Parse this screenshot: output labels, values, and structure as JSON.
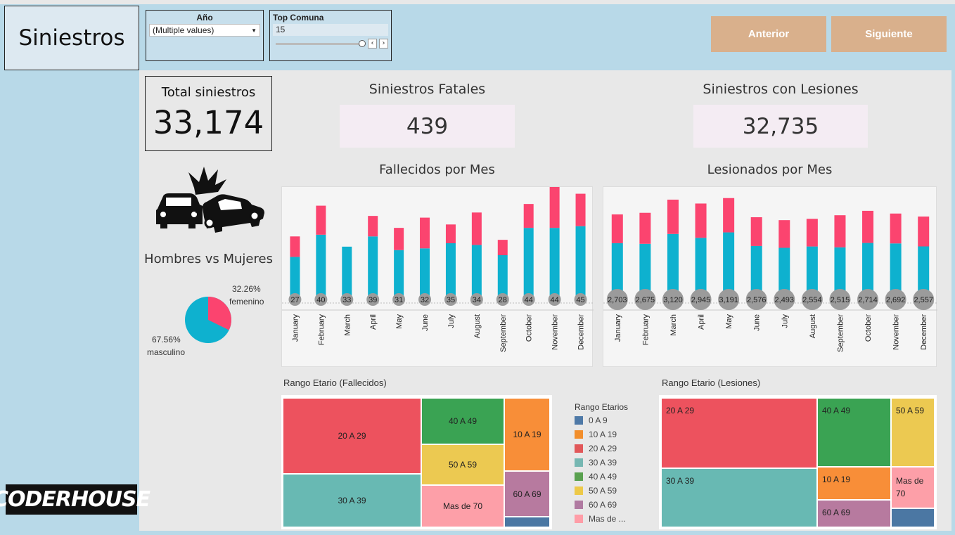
{
  "header": {
    "title": "Siniestros",
    "filters": {
      "year": {
        "label": "Año",
        "value": "(Multiple values)"
      },
      "top_comuna": {
        "label": "Top Comuna",
        "value": "15"
      }
    },
    "nav": {
      "prev_label": "Anterior",
      "next_label": "Siguiente"
    }
  },
  "kpis": {
    "total": {
      "label": "Total siniestros",
      "value": "33,174"
    },
    "fatales": {
      "label": "Siniestros Fatales",
      "value": "439"
    },
    "lesiones": {
      "label": "Siniestros con Lesiones",
      "value": "32,735"
    }
  },
  "gender": {
    "title": "Hombres vs Mujeres",
    "female_pct": "32.26%",
    "female_label": "femenino",
    "male_pct": "67.56%",
    "male_label": "masculino"
  },
  "brand": {
    "logo_text": "CODERHOUSE"
  },
  "colors": {
    "blue": "#0eb1cf",
    "pink": "#fb446f",
    "circle": "#9b9b9b"
  },
  "chart_data": [
    {
      "type": "bar",
      "title": "Fallecidos por Mes",
      "categories": [
        "January",
        "February",
        "March",
        "April",
        "May",
        "June",
        "July",
        "August",
        "September",
        "October",
        "November",
        "December"
      ],
      "series": [
        {
          "values": [
            27,
            40,
            33,
            39,
            31,
            32,
            35,
            34,
            28,
            44,
            44,
            45
          ],
          "color": "#0eb1cf"
        },
        {
          "values": [
            12,
            17,
            0,
            12,
            13,
            18,
            11,
            19,
            9,
            14,
            24,
            19
          ],
          "color": "#fb446f"
        }
      ],
      "labels": [
        "27",
        "40",
        "33",
        "39",
        "31",
        "32",
        "35",
        "34",
        "28",
        "44",
        "44",
        "45"
      ],
      "ylim": [
        0,
        70
      ]
    },
    {
      "type": "bar",
      "title": "Lesionados por Mes",
      "categories": [
        "January",
        "February",
        "March",
        "April",
        "May",
        "June",
        "July",
        "August",
        "September",
        "October",
        "November",
        "December"
      ],
      "series": [
        {
          "values": [
            2703,
            2675,
            3120,
            2945,
            3191,
            2576,
            2493,
            2554,
            2515,
            2714,
            2692,
            2557
          ],
          "color": "#0eb1cf"
        },
        {
          "values": [
            1300,
            1400,
            1550,
            1550,
            1550,
            1300,
            1250,
            1250,
            1450,
            1450,
            1350,
            1350
          ],
          "color": "#fb446f"
        }
      ],
      "labels": [
        "2,703",
        "2,675",
        "3,120",
        "2,945",
        "3,191",
        "2,576",
        "2,493",
        "2,554",
        "2,515",
        "2,714",
        "2,692",
        "2,557"
      ],
      "ylim": [
        0,
        5400
      ]
    }
  ],
  "treemaps": {
    "fallecidos": {
      "title": "Rango Etario (Fallecidos)",
      "cells": [
        "20 A 29",
        "30 A 39",
        "40 A 49",
        "50 A 59",
        "Mas de 70",
        "10 A 19",
        "60 A 69"
      ]
    },
    "lesiones": {
      "title": "Rango Etario (Lesiones)",
      "cells": [
        "20 A 29",
        "30 A 39",
        "40 A 49",
        "50 A 59",
        "10 A 19",
        "Mas de 70",
        "60 A 69"
      ]
    },
    "legend": {
      "title": "Rango Etarios",
      "items": [
        {
          "label": "0 A 9",
          "color": "#4e79a7"
        },
        {
          "label": "10 A 19",
          "color": "#f28e2b"
        },
        {
          "label": "20 A 29",
          "color": "#e15759"
        },
        {
          "label": "30 A 39",
          "color": "#76b7b2"
        },
        {
          "label": "40 A 49",
          "color": "#59a14f"
        },
        {
          "label": "50 A 59",
          "color": "#edc948"
        },
        {
          "label": "60 A 69",
          "color": "#b07aa1"
        },
        {
          "label": "Mas de ...",
          "color": "#ff9da7"
        }
      ]
    }
  }
}
